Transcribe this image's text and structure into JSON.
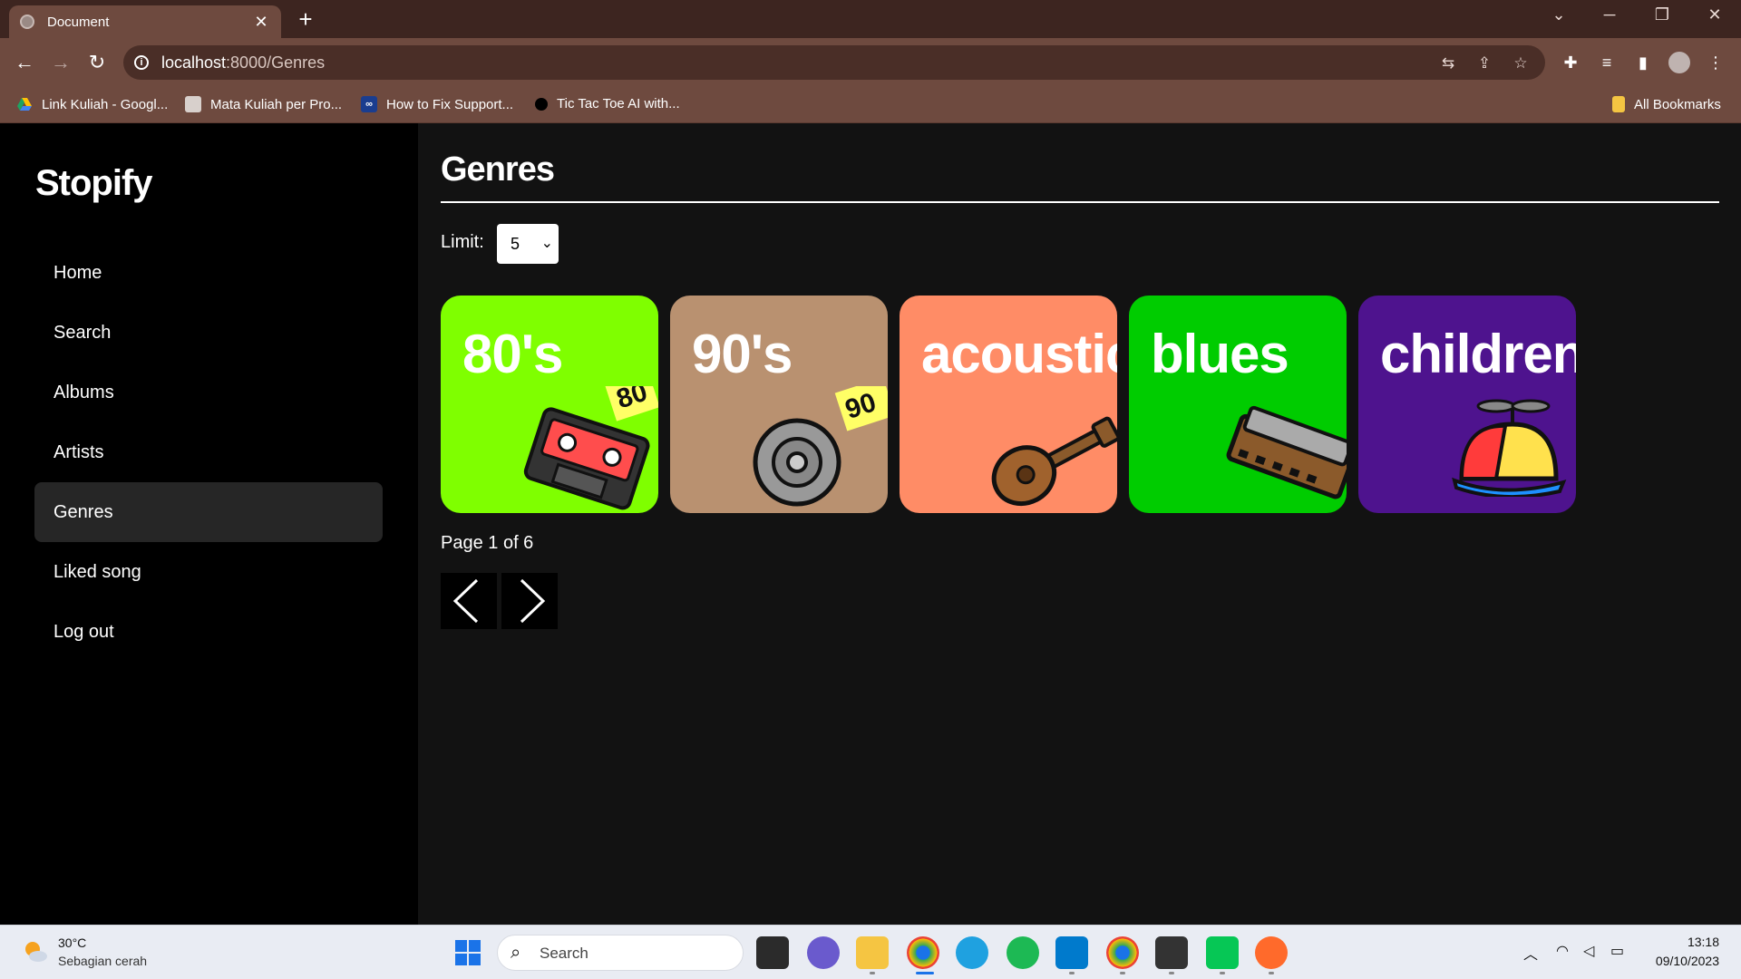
{
  "browser": {
    "tab_title": "Document",
    "tab_close": "✕",
    "new_tab": "+",
    "url_host": "localhost",
    "url_path": ":8000/Genres",
    "bookmarks": [
      {
        "label": "Link Kuliah - Googl...",
        "icon": "google-drive-icon"
      },
      {
        "label": "Mata Kuliah per Pro...",
        "icon": "site-icon"
      },
      {
        "label": "How to Fix Support...",
        "icon": "link-icon"
      },
      {
        "label": "Tic Tac Toe AI with...",
        "icon": "site-icon"
      }
    ],
    "all_bookmarks": "All Bookmarks"
  },
  "app": {
    "logo": "Stopify",
    "nav": [
      {
        "label": "Home",
        "active": false
      },
      {
        "label": "Search",
        "active": false
      },
      {
        "label": "Albums",
        "active": false
      },
      {
        "label": "Artists",
        "active": false
      },
      {
        "label": "Genres",
        "active": true
      },
      {
        "label": "Liked song",
        "active": false
      },
      {
        "label": "Log out",
        "active": false
      }
    ],
    "page_title": "Genres",
    "limit_label": "Limit:",
    "limit_value": "5",
    "genres": [
      {
        "name": "80's",
        "color": "#7fff00",
        "icon": "cassette-icon"
      },
      {
        "name": "90's",
        "color": "#b99170",
        "icon": "cd-icon"
      },
      {
        "name": "acoustic",
        "color": "#ff8c66",
        "icon": "guitar-icon"
      },
      {
        "name": "blues",
        "color": "#00cc00",
        "icon": "harmonica-icon"
      },
      {
        "name": "children",
        "color": "#4e138e",
        "icon": "propeller-cap-icon"
      }
    ],
    "page_info": "Page 1 of 6"
  },
  "taskbar": {
    "temperature": "30°C",
    "weather": "Sebagian cerah",
    "search_placeholder": "Search",
    "time": "13:18",
    "date": "09/10/2023"
  }
}
